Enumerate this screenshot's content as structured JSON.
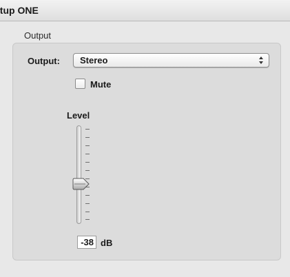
{
  "header": {
    "title": "etup ONE"
  },
  "output_group": {
    "label": "Output",
    "output_label": "Output:",
    "output_select_value": "Stereo",
    "mute_label": "Mute",
    "mute_checked": false,
    "level_label": "Level",
    "level_value": "-38",
    "level_unit": "dB",
    "level_fraction": 0.5
  }
}
